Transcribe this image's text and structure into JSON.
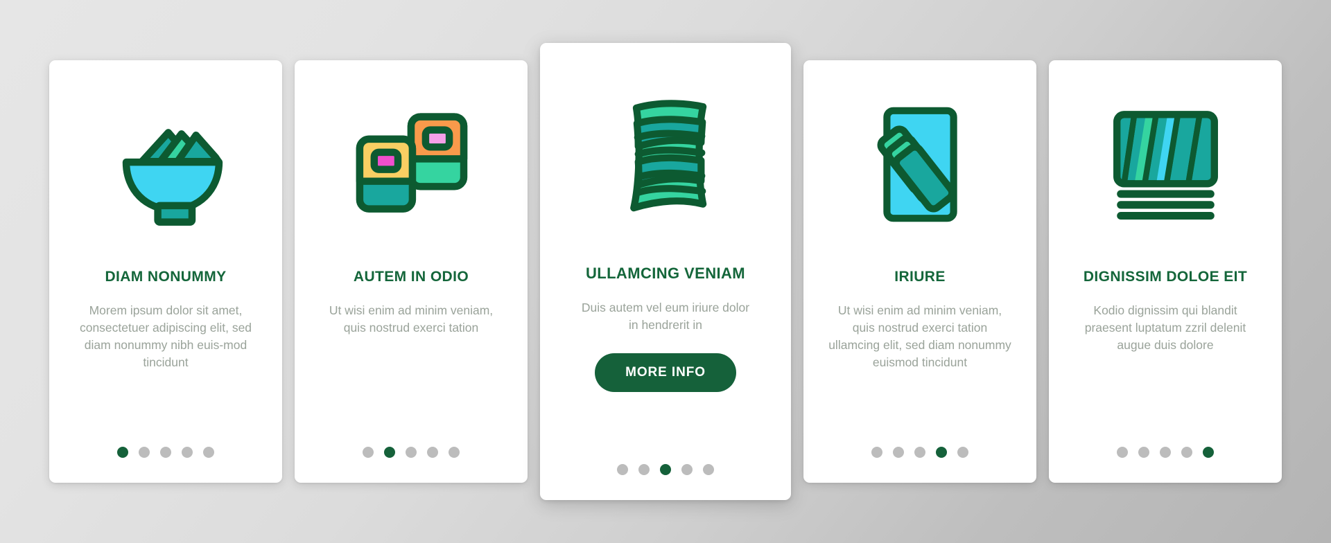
{
  "background": {
    "gradient_from": "#e6e6e6",
    "gradient_to": "#b4b4b4"
  },
  "theme": {
    "accent_dark_green": "#15613a",
    "title_green": "#14663a",
    "body_gray": "#9aa39a",
    "dot_inactive": "#bcbcbc",
    "card_white": "#ffffff",
    "icon_cyan": "#3fd5f2",
    "icon_teal": "#19a79e",
    "icon_mint": "#35d4a0",
    "icon_orange": "#f99a4b",
    "icon_yellow": "#f9cf63",
    "icon_pink": "#ef4fce",
    "icon_light_pink": "#f6a0e8",
    "icon_outline": "#0d5a31"
  },
  "cards": [
    {
      "icon_name": "salad-bowl-icon",
      "title": "DIAM NONUMMY",
      "body": "Morem ipsum dolor sit amet, consectetuer adipiscing elit, sed diam nonummy nibh euis-mod tincidunt",
      "dots": {
        "count": 5,
        "active": 0
      },
      "featured": false,
      "button": null
    },
    {
      "icon_name": "sushi-rolls-icon",
      "title": "AUTEM IN ODIO",
      "body": "Ut wisi enim ad minim veniam, quis nostrud exerci tation",
      "dots": {
        "count": 5,
        "active": 1
      },
      "featured": false,
      "button": null
    },
    {
      "icon_name": "nori-sheet-icon",
      "title": "ULLAMCING VENIAM",
      "body": "Duis autem vel eum iriure dolor in hendrerit in",
      "dots": {
        "count": 5,
        "active": 2
      },
      "featured": true,
      "button": {
        "label": "MORE INFO"
      }
    },
    {
      "icon_name": "seaweed-strips-plate-icon",
      "title": "IRIURE",
      "body": "Ut wisi enim ad minim veniam, quis nostrud exerci tation ullamcing elit, sed diam nonummy euismod tincidunt",
      "dots": {
        "count": 5,
        "active": 3
      },
      "featured": false,
      "button": null
    },
    {
      "icon_name": "seaweed-sheets-stack-icon",
      "title": "DIGNISSIM DOLOE EIT",
      "body": "Kodio dignissim qui blandit praesent luptatum zzril delenit augue duis dolore",
      "dots": {
        "count": 5,
        "active": 4
      },
      "featured": false,
      "button": null
    }
  ]
}
